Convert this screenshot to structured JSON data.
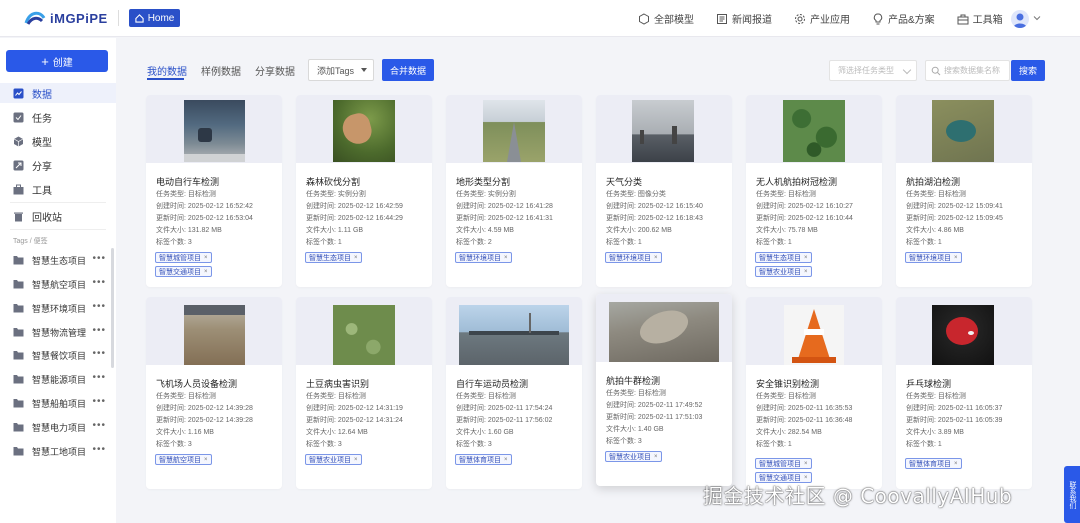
{
  "brand": {
    "name": "iMGPiPE",
    "accent": "#2a59e8"
  },
  "header": {
    "home_label": "Home",
    "nav": [
      {
        "label": "全部模型",
        "icon": "hexagon-icon"
      },
      {
        "label": "新闻报道",
        "icon": "news-icon"
      },
      {
        "label": "产业应用",
        "icon": "gear-icon"
      },
      {
        "label": "产品&方案",
        "icon": "bulb-icon"
      },
      {
        "label": "工具箱",
        "icon": "toolbox-icon"
      }
    ]
  },
  "sidebar": {
    "create_label": "创建",
    "items": [
      {
        "label": "数据",
        "icon": "data-icon"
      },
      {
        "label": "任务",
        "icon": "task-icon"
      },
      {
        "label": "模型",
        "icon": "cube-icon"
      },
      {
        "label": "分享",
        "icon": "share-icon"
      },
      {
        "label": "工具",
        "icon": "tool-icon"
      },
      {
        "label": "回收站",
        "icon": "trash-icon"
      }
    ],
    "tags_title": "Tags / 便签",
    "tags": [
      "智慧生态项目",
      "智慧航空项目",
      "智慧环境项目",
      "智慧物流管理",
      "智慧餐饮项目",
      "智慧能源项目",
      "智慧船舶项目",
      "智慧电力项目",
      "智慧工地项目"
    ]
  },
  "toolbar": {
    "tabs": [
      "我的数据",
      "样例数据",
      "分享数据"
    ],
    "tag_select": "添加Tags",
    "merge_label": "合并数据",
    "type_placeholder": "筛选择任务类型",
    "search_placeholder": "搜索数据集名称",
    "search_label": "搜索"
  },
  "cards": [
    {
      "title": "电动自行车检测",
      "type": "任务类型: 目标检测",
      "created": "创建时间: 2025-02-12 16:52:42",
      "updated": "更新时间: 2025-02-12 16:53:04",
      "size": "文件大小: 131.82 MB",
      "tags_count": "标签个数: 3",
      "chips": [
        "智慧城管项目",
        "智慧交通项目"
      ]
    },
    {
      "title": "森林砍伐分割",
      "type": "任务类型: 实例分割",
      "created": "创建时间: 2025-02-12 16:42:59",
      "updated": "更新时间: 2025-02-12 16:44:29",
      "size": "文件大小: 1.11 GB",
      "tags_count": "标签个数: 1",
      "chips": [
        "智慧生态项目"
      ]
    },
    {
      "title": "地形类型分割",
      "type": "任务类型: 实例分割",
      "created": "创建时间: 2025-02-12 16:41:28",
      "updated": "更新时间: 2025-02-12 16:41:31",
      "size": "文件大小: 4.59 MB",
      "tags_count": "标签个数: 2",
      "chips": [
        "智慧环境项目"
      ]
    },
    {
      "title": "天气分类",
      "type": "任务类型: 图像分类",
      "created": "创建时间: 2025-02-12 16:15:40",
      "updated": "更新时间: 2025-02-12 16:18:43",
      "size": "文件大小: 200.62 MB",
      "tags_count": "标签个数: 1",
      "chips": [
        "智慧环境项目"
      ]
    },
    {
      "title": "无人机航拍树冠检测",
      "type": "任务类型: 目标检测",
      "created": "创建时间: 2025-02-12 16:10:27",
      "updated": "更新时间: 2025-02-12 16:10:44",
      "size": "文件大小: 75.78 MB",
      "tags_count": "标签个数: 1",
      "chips": [
        "智慧生态项目",
        "智慧农业项目"
      ]
    },
    {
      "title": "航拍湖泊检测",
      "type": "任务类型: 目标检测",
      "created": "创建时间: 2025-02-12 15:09:41",
      "updated": "更新时间: 2025-02-12 15:09:45",
      "size": "文件大小: 4.86 MB",
      "tags_count": "标签个数: 1",
      "chips": [
        "智慧环境项目"
      ]
    },
    {
      "title": "飞机场人员设备检测",
      "type": "任务类型: 目标检测",
      "created": "创建时间: 2025-02-12 14:39:28",
      "updated": "更新时间: 2025-02-12 14:39:28",
      "size": "文件大小: 1.16 MB",
      "tags_count": "标签个数: 3",
      "chips": [
        "智慧航空项目"
      ]
    },
    {
      "title": "土豆病虫害识别",
      "type": "任务类型: 目标检测",
      "created": "创建时间: 2025-02-12 14:31:19",
      "updated": "更新时间: 2025-02-12 14:31:24",
      "size": "文件大小: 12.64 MB",
      "tags_count": "标签个数: 3",
      "chips": [
        "智慧农业项目"
      ]
    },
    {
      "title": "自行车运动员检测",
      "type": "任务类型: 目标检测",
      "created": "创建时间: 2025-02-11 17:54:24",
      "updated": "更新时间: 2025-02-11 17:56:02",
      "size": "文件大小: 1.60 GB",
      "tags_count": "标签个数: 3",
      "chips": [
        "智慧体育项目"
      ]
    },
    {
      "title": "航拍牛群检测",
      "type": "任务类型: 目标检测",
      "created": "创建时间: 2025-02-11 17:49:52",
      "updated": "更新时间: 2025-02-11 17:51:03",
      "size": "文件大小: 1.40 GB",
      "tags_count": "标签个数: 3",
      "chips": [
        "智慧农业项目"
      ]
    },
    {
      "title": "安全锥识别检测",
      "type": "任务类型: 目标检测",
      "created": "创建时间: 2025-02-11 16:35:53",
      "updated": "更新时间: 2025-02-11 16:36:48",
      "size": "文件大小: 282.54 MB",
      "tags_count": "标签个数: 1",
      "chips": [
        "智慧城管项目",
        "智慧交通项目"
      ]
    },
    {
      "title": "乒乓球检测",
      "type": "任务类型: 目标检测",
      "created": "创建时间: 2025-02-11 16:05:37",
      "updated": "更新时间: 2025-02-11 16:05:39",
      "size": "文件大小: 3.89 MB",
      "tags_count": "标签个数: 1",
      "chips": [
        "智慧体育项目"
      ]
    }
  ],
  "watermark": "掘金技术社区 @ CoovallyAIHub",
  "contact_label": "联系我们"
}
